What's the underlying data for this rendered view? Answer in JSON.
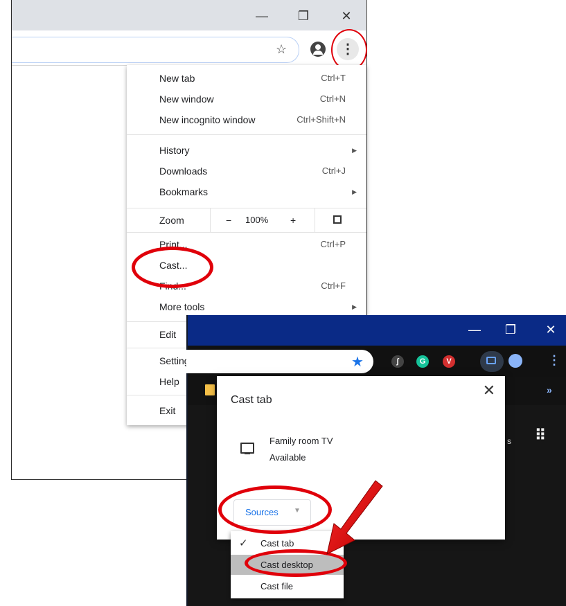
{
  "window_controls": {
    "minimize": "—",
    "restore": "❐",
    "close": "✕"
  },
  "toolbar": {
    "bookmark_star": "☆",
    "menu_glyph": "⋮"
  },
  "chrome_menu": {
    "group1": [
      {
        "label": "New tab",
        "shortcut": "Ctrl+T"
      },
      {
        "label": "New window",
        "shortcut": "Ctrl+N"
      },
      {
        "label": "New incognito window",
        "shortcut": "Ctrl+Shift+N"
      }
    ],
    "group2": [
      {
        "label": "History",
        "submenu": true
      },
      {
        "label": "Downloads",
        "shortcut": "Ctrl+J"
      },
      {
        "label": "Bookmarks",
        "submenu": true
      }
    ],
    "zoom": {
      "label": "Zoom",
      "minus": "−",
      "value": "100%",
      "plus": "+"
    },
    "group3": [
      {
        "label": "Print...",
        "shortcut": "Ctrl+P"
      },
      {
        "label": "Cast..."
      },
      {
        "label": "Find...",
        "shortcut": "Ctrl+F"
      },
      {
        "label": "More tools",
        "submenu": true
      }
    ],
    "edit": "Edit",
    "settings": "Settings",
    "help": "Help",
    "exit": "Exit",
    "submenu_arrow": "▶"
  },
  "dark_window": {
    "window_controls": {
      "minimize": "—",
      "restore": "❐",
      "close": "✕"
    },
    "star": "★",
    "extensions": [
      {
        "glyph": "ʃ",
        "color": "#444444"
      },
      {
        "glyph": "G",
        "color": "#15c39a"
      },
      {
        "glyph": "V",
        "color": "#d32f2f"
      }
    ],
    "menu_glyph": "⋮",
    "overflow_chevron": "»",
    "apps_grid": "⠿",
    "peek_text": "s"
  },
  "cast_dialog": {
    "title": "Cast tab",
    "close": "✕",
    "device_name": "Family room TV",
    "device_status": "Available",
    "sources_label": "Sources",
    "sources_caret": "▼"
  },
  "sources_menu": {
    "checkmark": "✓",
    "items": [
      {
        "label": "Cast tab",
        "checked": true
      },
      {
        "label": "Cast desktop",
        "highlighted": true
      },
      {
        "label": "Cast file"
      }
    ]
  },
  "annotation_color": "#e0000a"
}
